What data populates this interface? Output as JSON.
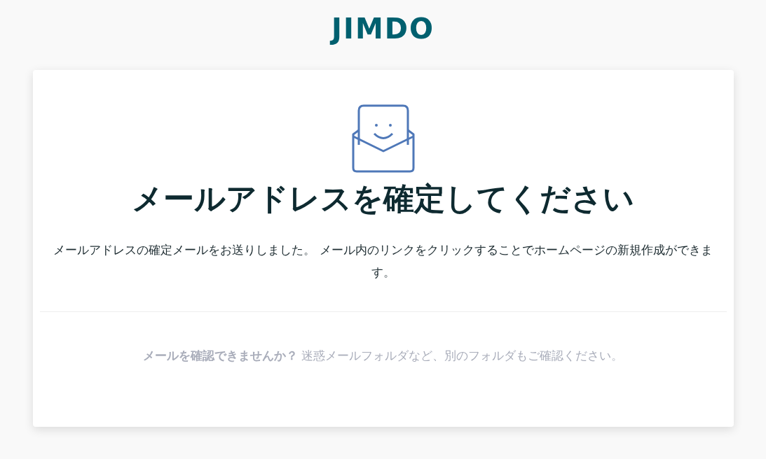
{
  "logo": "JIMDO",
  "card": {
    "title": "メールアドレスを確定してください",
    "message": "メールアドレスの確定メールをお送りしました。 メール内のリンクをクリックすることでホームページの新規作成ができます。",
    "hint": "**メールを確認できませんか？** 迷惑メールフォルダなど、別のフォルダもご確認ください。"
  }
}
